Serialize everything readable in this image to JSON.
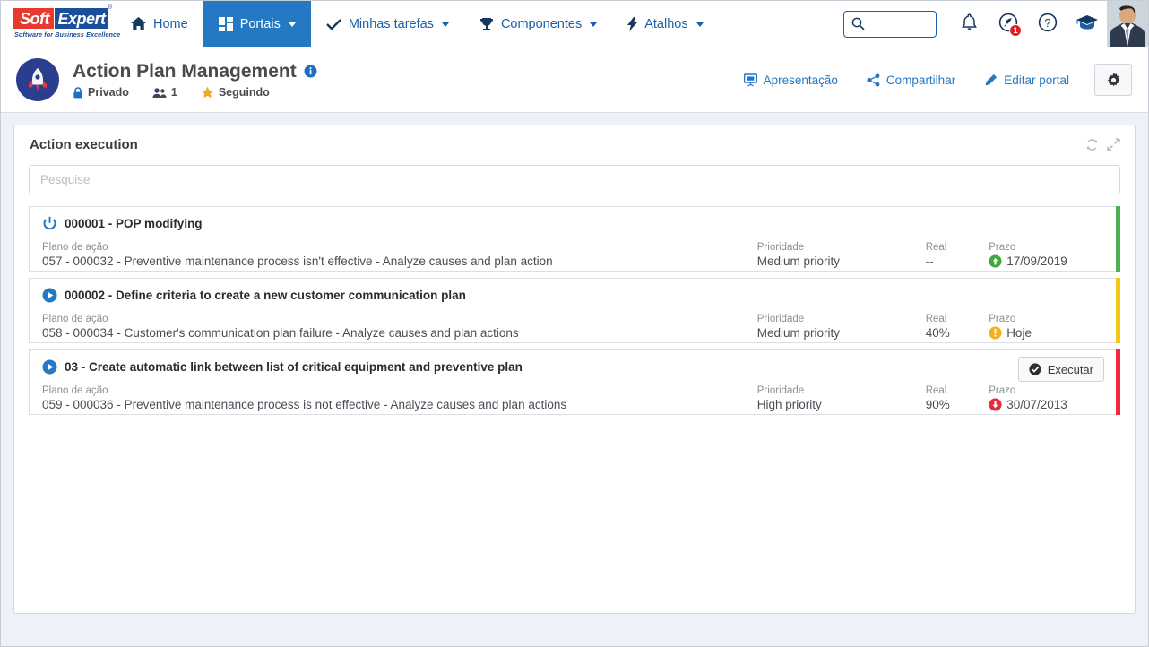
{
  "topnav": {
    "logo": {
      "soft": "Soft",
      "expert": "Expert",
      "reg": "®",
      "tagline": "Software for Business Excellence"
    },
    "items": [
      {
        "label": "Home",
        "icon": "home-icon",
        "caret": false,
        "active": false
      },
      {
        "label": "Portais",
        "icon": "grid-icon",
        "caret": true,
        "active": true
      },
      {
        "label": "Minhas tarefas",
        "icon": "check-icon",
        "caret": true,
        "active": false
      },
      {
        "label": "Componentes",
        "icon": "trophy-icon",
        "caret": true,
        "active": false
      },
      {
        "label": "Atalhos",
        "icon": "bolt-icon",
        "caret": true,
        "active": false
      }
    ],
    "search": {
      "value": "",
      "placeholder": ""
    },
    "notification_badge": "1"
  },
  "portal": {
    "icon": "rocket-icon",
    "title": "Action Plan Management",
    "info_icon": "info-icon",
    "visibility": "Privado",
    "members_count": "1",
    "following": "Seguindo",
    "actions": [
      {
        "label": "Apresentação",
        "icon": "presentation-icon"
      },
      {
        "label": "Compartilhar",
        "icon": "share-icon"
      },
      {
        "label": "Editar portal",
        "icon": "pencil-icon"
      }
    ],
    "settings_icon": "gear-icon"
  },
  "panel": {
    "title": "Action execution",
    "refresh_icon": "refresh-icon",
    "expand_icon": "expand-icon",
    "search": {
      "value": "",
      "placeholder": "Pesquise"
    },
    "labels": {
      "plan": "Plano de ação",
      "priority": "Prioridade",
      "real": "Real",
      "prazo": "Prazo"
    },
    "cards": [
      {
        "status_icon": "power-icon",
        "title": "000001 - POP modifying",
        "plan": "057 - 000032 - Preventive maintenance process isn't effective - Analyze causes and plan action",
        "priority": "Medium priority",
        "real": "--",
        "prazo": "17/09/2019",
        "prazo_icon": "arrow-up-circle-icon",
        "prazo_color": "#3da83d",
        "bar_color": "#4caf50",
        "exec_button": null
      },
      {
        "status_icon": "play-icon",
        "title": "000002 - Define criteria to create a new customer communication plan",
        "plan": "058 - 000034 - Customer's communication plan failure - Analyze causes and plan actions",
        "priority": "Medium priority",
        "real": "40%",
        "prazo": "Hoje",
        "prazo_icon": "exclamation-circle-icon",
        "prazo_color": "#f2b01e",
        "bar_color": "#f5c518",
        "exec_button": null
      },
      {
        "status_icon": "play-icon",
        "title": "03 - Create automatic link between list of critical equipment and preventive plan",
        "plan": "059 - 000036 - Preventive maintenance process is not effective - Analyze causes and plan actions",
        "priority": "High priority",
        "real": "90%",
        "prazo": "30/07/2013",
        "prazo_icon": "arrow-down-circle-icon",
        "prazo_color": "#e52b38",
        "bar_color": "#f02a3c",
        "exec_button": {
          "label": "Executar",
          "icon": "check-circle-icon"
        }
      }
    ]
  },
  "colors": {
    "brand_blue": "#2579c4",
    "link_blue": "#1b5fa8",
    "page_bg": "#eef1f7",
    "green": "#4caf50",
    "amber": "#f5c518",
    "red": "#f02a3c"
  }
}
